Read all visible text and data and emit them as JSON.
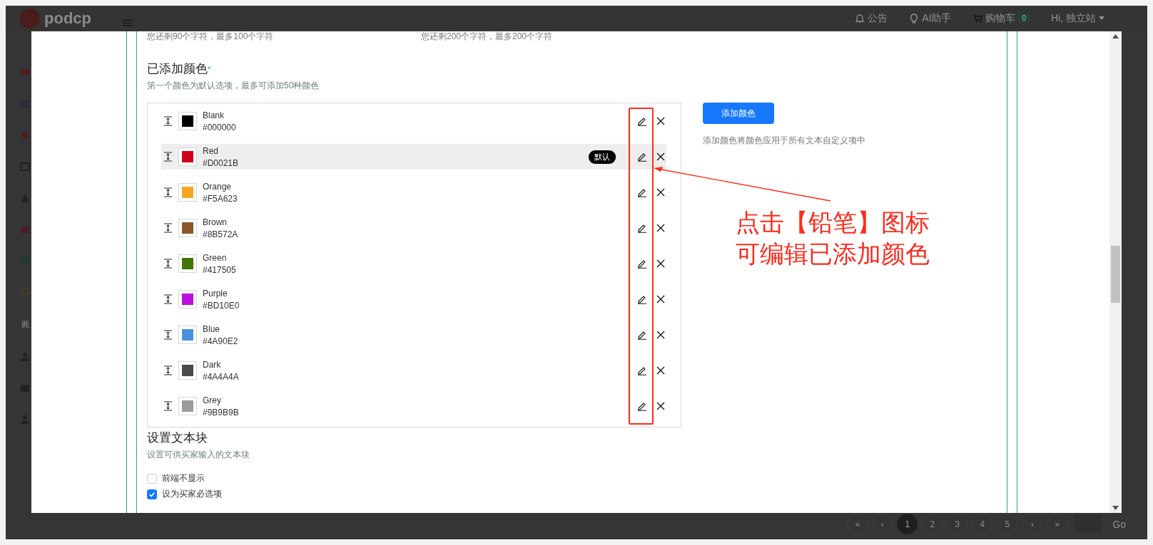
{
  "header": {
    "logo": "podcp",
    "nav": [
      {
        "kind": "bell",
        "label": "公告"
      },
      {
        "kind": "bulb",
        "label": "AI助手"
      },
      {
        "kind": "cart",
        "label": "购物车",
        "badge": "0"
      },
      {
        "kind": "user",
        "label": "Hi, 独立站"
      }
    ]
  },
  "sidebar": {
    "section_label": "账"
  },
  "pagination": {
    "items": [
      {
        "label": "«",
        "selected": false
      },
      {
        "label": "‹",
        "selected": false
      },
      {
        "label": "1",
        "selected": true
      },
      {
        "label": "2",
        "selected": false
      },
      {
        "label": "3",
        "selected": false
      },
      {
        "label": "4",
        "selected": false
      },
      {
        "label": "5",
        "selected": false
      },
      {
        "label": "›",
        "selected": false
      },
      {
        "label": "»",
        "selected": false
      }
    ],
    "go": "Go"
  },
  "modal": {
    "char_hints": [
      "您还剩90个字符，最多100个字符",
      "您还剩200个字符，最多200个字符"
    ],
    "colors_section": {
      "title": "已添加颜色",
      "required_mark": "*",
      "hint": "第一个颜色为默认选项，最多可添加50种颜色",
      "colors": [
        {
          "name": "Blank",
          "hex": "#000000",
          "color": "#000000",
          "selected": false
        },
        {
          "name": "Red",
          "hex": "#D0021B",
          "color": "#d0021b",
          "selected": true,
          "badge": "默认"
        },
        {
          "name": "Orange",
          "hex": "#F5A623",
          "color": "#f5a623",
          "selected": false
        },
        {
          "name": "Brown",
          "hex": "#8B572A",
          "color": "#8b572a",
          "selected": false
        },
        {
          "name": "Green",
          "hex": "#417505",
          "color": "#417505",
          "selected": false
        },
        {
          "name": "Purple",
          "hex": "#BD10E0",
          "color": "#bd10e0",
          "selected": false
        },
        {
          "name": "Blue",
          "hex": "#4A90E2",
          "color": "#4a90e2",
          "selected": false
        },
        {
          "name": "Dark",
          "hex": "#4A4A4A",
          "color": "#4a4a4a",
          "selected": false
        },
        {
          "name": "Grey",
          "hex": "#9B9B9B",
          "color": "#9b9b9b",
          "selected": false
        }
      ],
      "add_button": "添加颜色",
      "add_hint": "添加颜色将颜色应用于所有文本自定义项中"
    },
    "text_block_section": {
      "title": "设置文本块",
      "hint": "设置可供买家输入的文本块",
      "options": [
        {
          "label": "前端不显示",
          "checked": false
        },
        {
          "label": "设为买家必选项",
          "checked": true
        }
      ]
    }
  },
  "annotation": {
    "lines": [
      "点击【铅笔】图标",
      "可编辑已添加颜色"
    ]
  }
}
